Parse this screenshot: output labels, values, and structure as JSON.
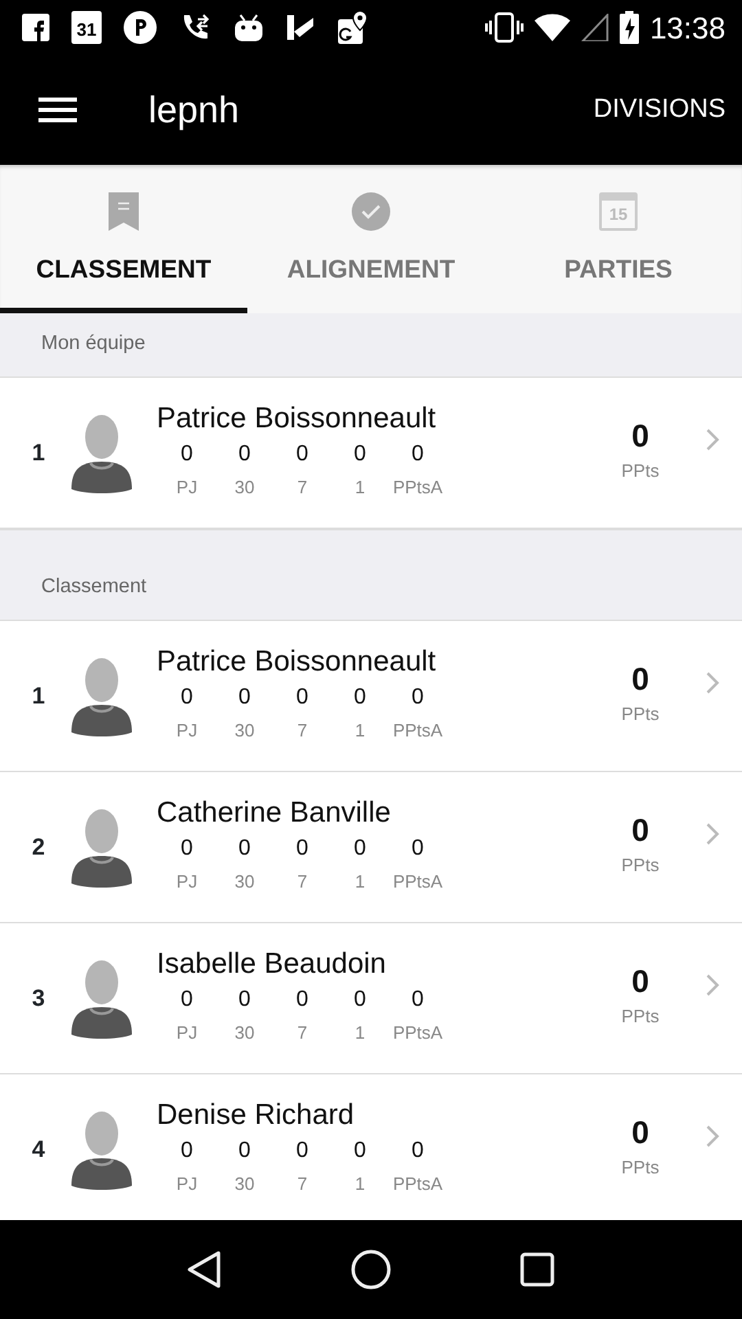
{
  "status_bar": {
    "calendar_day": "31",
    "time": "13:38"
  },
  "toolbar": {
    "title": "lepnh",
    "action": "DIVISIONS"
  },
  "tabs": [
    {
      "label": "CLASSEMENT",
      "kind": "bookmark",
      "selected": true
    },
    {
      "label": "ALIGNEMENT",
      "kind": "check",
      "selected": false
    },
    {
      "label": "PARTIES",
      "kind": "calendar",
      "icon_text": "15",
      "selected": false
    }
  ],
  "sections": [
    {
      "title": "Mon équipe",
      "rows": [
        {
          "rank": "1",
          "name": "Patrice Boissonneault",
          "stats": [
            {
              "value": "0",
              "label": "PJ"
            },
            {
              "value": "0",
              "label": "30"
            },
            {
              "value": "0",
              "label": "7"
            },
            {
              "value": "0",
              "label": "1"
            },
            {
              "value": "0",
              "label": "PPtsA"
            }
          ],
          "points": "0",
          "points_label": "PPts"
        }
      ]
    },
    {
      "title": "Classement",
      "rows": [
        {
          "rank": "1",
          "name": "Patrice Boissonneault",
          "stats": [
            {
              "value": "0",
              "label": "PJ"
            },
            {
              "value": "0",
              "label": "30"
            },
            {
              "value": "0",
              "label": "7"
            },
            {
              "value": "0",
              "label": "1"
            },
            {
              "value": "0",
              "label": "PPtsA"
            }
          ],
          "points": "0",
          "points_label": "PPts"
        },
        {
          "rank": "2",
          "name": "Catherine Banville",
          "stats": [
            {
              "value": "0",
              "label": "PJ"
            },
            {
              "value": "0",
              "label": "30"
            },
            {
              "value": "0",
              "label": "7"
            },
            {
              "value": "0",
              "label": "1"
            },
            {
              "value": "0",
              "label": "PPtsA"
            }
          ],
          "points": "0",
          "points_label": "PPts"
        },
        {
          "rank": "3",
          "name": "Isabelle Beaudoin",
          "stats": [
            {
              "value": "0",
              "label": "PJ"
            },
            {
              "value": "0",
              "label": "30"
            },
            {
              "value": "0",
              "label": "7"
            },
            {
              "value": "0",
              "label": "1"
            },
            {
              "value": "0",
              "label": "PPtsA"
            }
          ],
          "points": "0",
          "points_label": "PPts"
        },
        {
          "rank": "4",
          "name": "Denise Richard",
          "stats": [
            {
              "value": "0",
              "label": "PJ"
            },
            {
              "value": "0",
              "label": "30"
            },
            {
              "value": "0",
              "label": "7"
            },
            {
              "value": "0",
              "label": "1"
            },
            {
              "value": "0",
              "label": "PPtsA"
            }
          ],
          "points": "0",
          "points_label": "PPts"
        }
      ]
    }
  ]
}
